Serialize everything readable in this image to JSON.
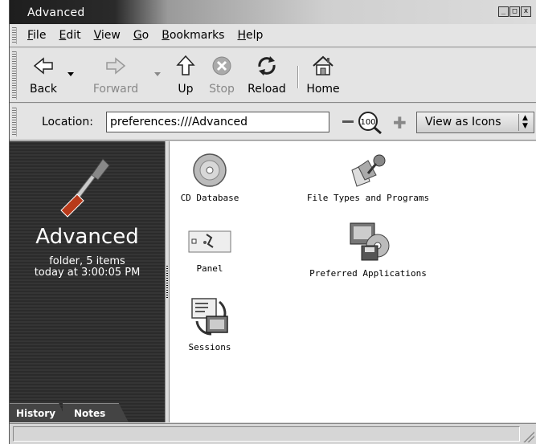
{
  "window": {
    "title": "Advanced",
    "controls": [
      "_",
      "□",
      "x"
    ]
  },
  "menubar": [
    {
      "label": "File",
      "mnemonic": "F",
      "rest": "ile"
    },
    {
      "label": "Edit",
      "mnemonic": "E",
      "rest": "dit"
    },
    {
      "label": "View",
      "mnemonic": "V",
      "rest": "iew"
    },
    {
      "label": "Go",
      "mnemonic": "G",
      "rest": "o"
    },
    {
      "label": "Bookmarks",
      "mnemonic": "B",
      "rest": "ookmarks"
    },
    {
      "label": "Help",
      "mnemonic": "H",
      "rest": "elp"
    }
  ],
  "toolbar": {
    "back": "Back",
    "forward": "Forward",
    "up": "Up",
    "stop": "Stop",
    "reload": "Reload",
    "home": "Home"
  },
  "location": {
    "label": "Location:",
    "value": "preferences:///Advanced",
    "zoom": "100",
    "view_mode": "View as Icons"
  },
  "sidebar": {
    "title": "Advanced",
    "info_line1": "folder, 5 items",
    "info_line2": "today at 3:00:05 PM",
    "tabs": [
      "History",
      "Notes"
    ]
  },
  "items": [
    {
      "label": "CD Database",
      "icon": "cd-icon"
    },
    {
      "label": "File Types and Programs",
      "icon": "file-types-icon"
    },
    {
      "label": "Panel",
      "icon": "panel-icon"
    },
    {
      "label": "Preferred Applications",
      "icon": "preferred-apps-icon"
    },
    {
      "label": "Sessions",
      "icon": "sessions-icon"
    }
  ]
}
